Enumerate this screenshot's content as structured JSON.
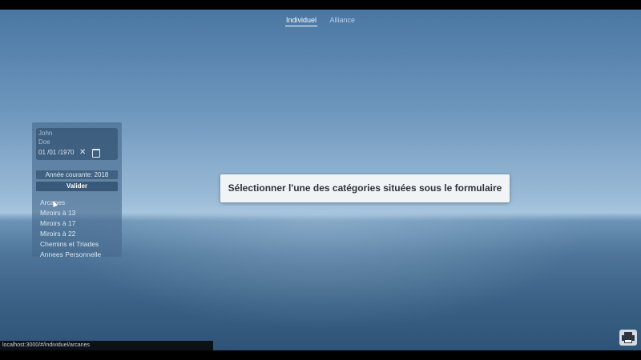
{
  "tabs": [
    {
      "label": "Individuel",
      "active": true
    },
    {
      "label": "Alliance",
      "active": false
    }
  ],
  "form": {
    "first_name": "John",
    "last_name": "Doe",
    "birth_date": "01 /01 /1970",
    "clear_icon": "close-icon",
    "calendar_icon": "calendar-icon",
    "current_year_text": "Année courante: 2018",
    "submit_label": "Valider"
  },
  "categories": [
    "Arcanes",
    "Miroirs à 13",
    "Miroirs à 17",
    "Miroirs à 22",
    "Chemins et Triades",
    "Annees Personnelle"
  ],
  "message": "Sélectionner l'une des catégories situées sous le formulaire",
  "print_icon": "printer-icon",
  "status_url": "localhost:3000/#/individuel/arcanes",
  "colors": {
    "accent": "#ffffff",
    "panel": "#46698c",
    "message_bg": "#f1f4f7"
  }
}
